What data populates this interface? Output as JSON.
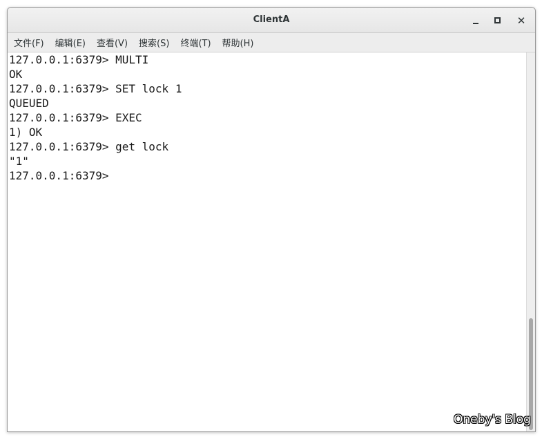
{
  "window": {
    "title": "ClientA",
    "buttons": {
      "minimize": "minimize-icon",
      "maximize": "maximize-icon",
      "close": "✕"
    }
  },
  "menubar": {
    "items": [
      {
        "label": "文件(F)"
      },
      {
        "label": "编辑(E)"
      },
      {
        "label": "查看(V)"
      },
      {
        "label": "搜索(S)"
      },
      {
        "label": "终端(T)"
      },
      {
        "label": "帮助(H)"
      }
    ]
  },
  "terminal": {
    "lines": [
      "127.0.0.1:6379> MULTI",
      "OK",
      "127.0.0.1:6379> SET lock 1",
      "QUEUED",
      "127.0.0.1:6379> EXEC",
      "1) OK",
      "127.0.0.1:6379> get lock",
      "\"1\"",
      "127.0.0.1:6379> "
    ]
  },
  "watermark": "Oneby's Blog",
  "colors": {
    "titlebar": "#e6e6e6",
    "menubar": "#ededed",
    "terminal_bg": "#ffffff",
    "terminal_fg": "#1a1a1a",
    "scroll_thumb": "#a8a8a8"
  }
}
